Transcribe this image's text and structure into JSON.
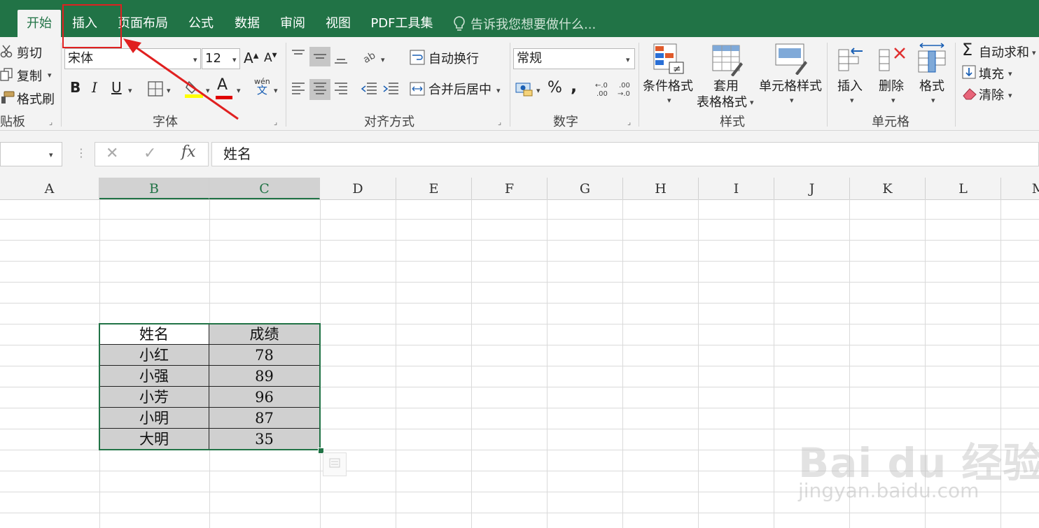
{
  "tabs": [
    {
      "label": "开始",
      "active": true
    },
    {
      "label": "插入",
      "active": false
    },
    {
      "label": "页面布局",
      "active": false
    },
    {
      "label": "公式",
      "active": false
    },
    {
      "label": "数据",
      "active": false
    },
    {
      "label": "审阅",
      "active": false
    },
    {
      "label": "视图",
      "active": false
    },
    {
      "label": "PDF工具集",
      "active": false
    }
  ],
  "tell_me": "告诉我您想要做什么...",
  "clipboard": {
    "cut": "剪切",
    "copy": "复制",
    "format_painter": "格式刷",
    "group": "贴板"
  },
  "font": {
    "name": "宋体",
    "size": "12",
    "bold": "B",
    "italic": "I",
    "underline": "U",
    "font_color_glyph": "A",
    "phonetic_top": "wén",
    "phonetic_bottom": "文",
    "group": "字体"
  },
  "alignment": {
    "wrap_text": "自动换行",
    "merge_center": "合并后居中",
    "group": "对齐方式"
  },
  "number": {
    "format": "常规",
    "percent": "%",
    "comma": ",",
    "group": "数字"
  },
  "styles": {
    "conditional": "条件格式",
    "table_format_1": "套用",
    "table_format_2": "表格格式",
    "cell_styles": "单元格样式",
    "group": "样式"
  },
  "cells": {
    "insert": "插入",
    "delete": "删除",
    "format": "格式",
    "group": "单元格"
  },
  "editing": {
    "autosum": "自动求和",
    "fill": "填充",
    "clear": "清除"
  },
  "formula_bar": {
    "content": "姓名",
    "fx": "fx"
  },
  "columns": [
    "A",
    "B",
    "C",
    "D",
    "E",
    "F",
    "G",
    "H",
    "I",
    "J",
    "K",
    "L",
    "M"
  ],
  "table": {
    "headers": [
      "姓名",
      "成绩"
    ],
    "rows": [
      [
        "小红",
        "78"
      ],
      [
        "小强",
        "89"
      ],
      [
        "小芳",
        "96"
      ],
      [
        "小明",
        "87"
      ],
      [
        "大明",
        "35"
      ]
    ]
  },
  "watermark": {
    "text": "Bai du 经验",
    "url": "jingyan.baidu.com"
  },
  "colors": {
    "accent": "#217346",
    "annotation": "#e02020",
    "selection_fill": "#d0d0d0"
  }
}
